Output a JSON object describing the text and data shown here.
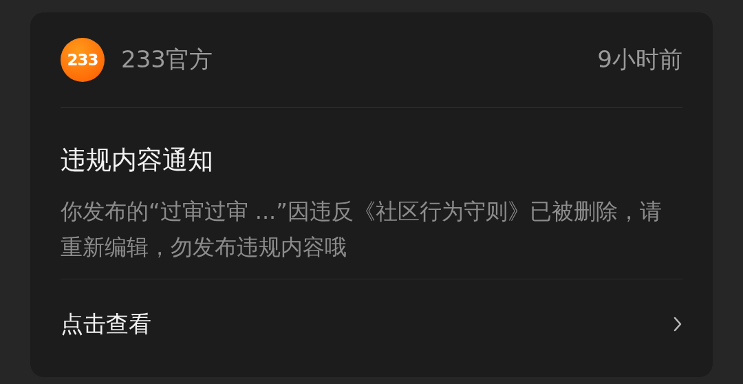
{
  "notice": {
    "logo_text": "233",
    "sender": "233官方",
    "time": "9小时前",
    "title": "违规内容通知",
    "body": "你发布的“过审过审 ...”因违反《社区行为守则》已被删除，请重新编辑，勿发布违规内容哦",
    "action": "点击查看"
  }
}
